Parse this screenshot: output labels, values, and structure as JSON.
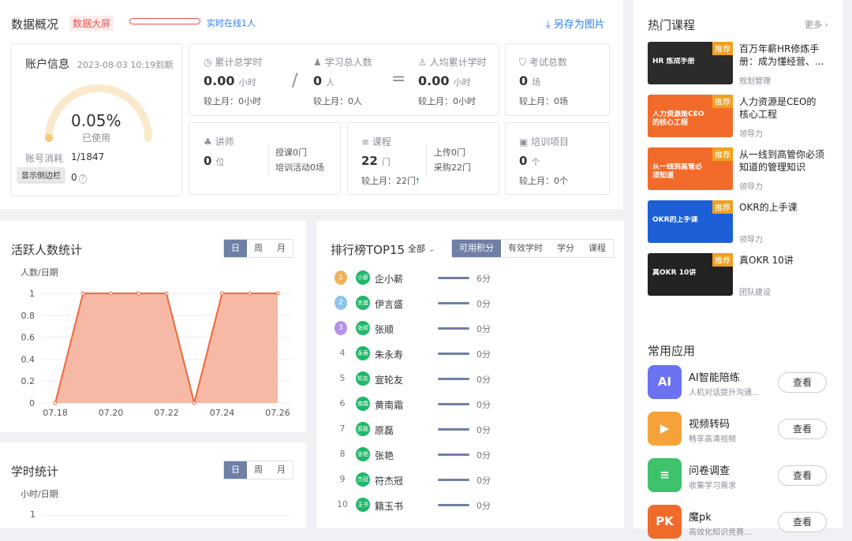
{
  "header": {
    "title": "数据概况",
    "screen_tag": "数据大屏",
    "online": "实时在线1人",
    "save_image": "另存为图片"
  },
  "account": {
    "title": "账户信息",
    "expiry": "2023-08-03 10:19到期",
    "gauge_percent": "0.05%",
    "gauge_label": "已使用",
    "usage_fraction": 0.0005,
    "quota_label": "账号消耗",
    "quota_value": "1/1847",
    "sidebar_toggle": "显示侧边栏",
    "other_value": "0"
  },
  "stats": {
    "total_hours": {
      "label": "累计总学时",
      "value": "0.00",
      "unit": "小时",
      "compare": "较上月：0小时"
    },
    "total_learners": {
      "label": "学习总人数",
      "value": "0",
      "unit": "人",
      "compare": "较上月：0人"
    },
    "avg_hours": {
      "label": "人均累计学时",
      "value": "0.00",
      "unit": "小时",
      "compare": "较上月：0小时"
    },
    "exams": {
      "label": "考试总数",
      "value": "0",
      "unit": "场",
      "compare": "较上月：0场"
    },
    "lecturers": {
      "label": "讲师",
      "value": "0",
      "unit": "位",
      "sub1": "授课0门",
      "sub2": "培训活动0场"
    },
    "courses": {
      "label": "课程",
      "value": "22",
      "unit": "门",
      "sub1": "上传0门",
      "sub2": "采购22门",
      "compare": "较上月：22门"
    },
    "projects": {
      "label": "培训项目",
      "value": "0",
      "unit": "个",
      "compare": "较上月：0个"
    }
  },
  "active_chart": {
    "title": "活跃人数统计",
    "tabs": [
      "日",
      "周",
      "月"
    ],
    "ylabel": "人数/日期"
  },
  "hours_chart": {
    "title": "学时统计",
    "tabs": [
      "日",
      "周",
      "月"
    ],
    "ylabel": "小时/日期",
    "ytick": "1"
  },
  "chart_data": {
    "type": "area",
    "ylabel": "人数/日期",
    "x_ticks": [
      "07.18",
      "07.20",
      "07.22",
      "07.24",
      "07.26"
    ],
    "y_ticks": [
      "0",
      "0.2",
      "0.4",
      "0.6",
      "0.8",
      "1"
    ],
    "ylim": [
      0,
      1
    ],
    "x": [
      "07.18",
      "07.19",
      "07.20",
      "07.21",
      "07.22",
      "07.23",
      "07.24",
      "07.25",
      "07.26"
    ],
    "values": [
      0,
      1,
      1,
      1,
      1,
      0,
      1,
      1,
      1
    ]
  },
  "ranking": {
    "title": "排行榜TOP15",
    "filter": "全部",
    "tabs": [
      "可用积分",
      "有效学时",
      "学分",
      "课程"
    ],
    "rows": [
      {
        "rank": "",
        "avatar": "小薪",
        "name": "企小薪",
        "score": "6分",
        "fill": 1.0
      },
      {
        "rank": "",
        "avatar": "言盛",
        "name": "伊言盛",
        "score": "0分",
        "fill": 1.0
      },
      {
        "rank": "",
        "avatar": "张顺",
        "name": "张顺",
        "score": "0分",
        "fill": 1.0
      },
      {
        "rank": "4",
        "avatar": "永寿",
        "name": "朱永寿",
        "score": "0分",
        "fill": 1.0
      },
      {
        "rank": "5",
        "avatar": "轮友",
        "name": "宣轮友",
        "score": "0分",
        "fill": 1.0
      },
      {
        "rank": "6",
        "avatar": "南霜",
        "name": "黄南霜",
        "score": "0分",
        "fill": 1.0
      },
      {
        "rank": "7",
        "avatar": "原磊",
        "name": "原磊",
        "score": "0分",
        "fill": 1.0
      },
      {
        "rank": "8",
        "avatar": "张艳",
        "name": "张艳",
        "score": "0分",
        "fill": 1.0
      },
      {
        "rank": "9",
        "avatar": "杰冠",
        "name": "符杰冠",
        "score": "0分",
        "fill": 1.0
      },
      {
        "rank": "10",
        "avatar": "玉书",
        "name": "籍玉书",
        "score": "0分",
        "fill": 1.0
      }
    ]
  },
  "hot_courses": {
    "title": "热门课程",
    "more": "更多",
    "badge": "推荐",
    "items": [
      {
        "title1": "百万年薪HR修炼手",
        "title2": "册：成为懂经营、...",
        "tag": "规划管理",
        "thumb_text": "HR 炼成手册",
        "color": "#2b2b2b"
      },
      {
        "title1": "人力资源是CEO的",
        "title2": "核心工程",
        "tag": "领导力",
        "thumb_text": "人力资源是CEO的核心工程",
        "color": "#f26b2a"
      },
      {
        "title1": "从一线到高管你必须",
        "title2": "知道的管理知识",
        "tag": "领导力",
        "thumb_text": "从一线到高管必须知道",
        "color": "#f26b2a"
      },
      {
        "title1": "OKR的上手课",
        "title2": "",
        "tag": "领导力",
        "thumb_text": "OKR的上手课",
        "color": "#1d5fd6"
      },
      {
        "title1": "真OKR 10讲",
        "title2": "",
        "tag": "团队建设",
        "thumb_text": "真OKR 10讲",
        "color": "#222"
      }
    ]
  },
  "apps": {
    "title": "常用应用",
    "view": "查看",
    "items": [
      {
        "name": "AI智能陪练",
        "desc": "人机对话提升沟通...",
        "icon": "AI",
        "color": "#6b72f0"
      },
      {
        "name": "视频转码",
        "desc": "畅享高清视频",
        "icon": "▶",
        "color": "#f5a23a"
      },
      {
        "name": "问卷调查",
        "desc": "收集学习需求",
        "icon": "≡",
        "color": "#3ec26b"
      },
      {
        "name": "魔pk",
        "desc": "高效化知识竞赛...",
        "icon": "PK",
        "color": "#f06a2a"
      }
    ]
  }
}
